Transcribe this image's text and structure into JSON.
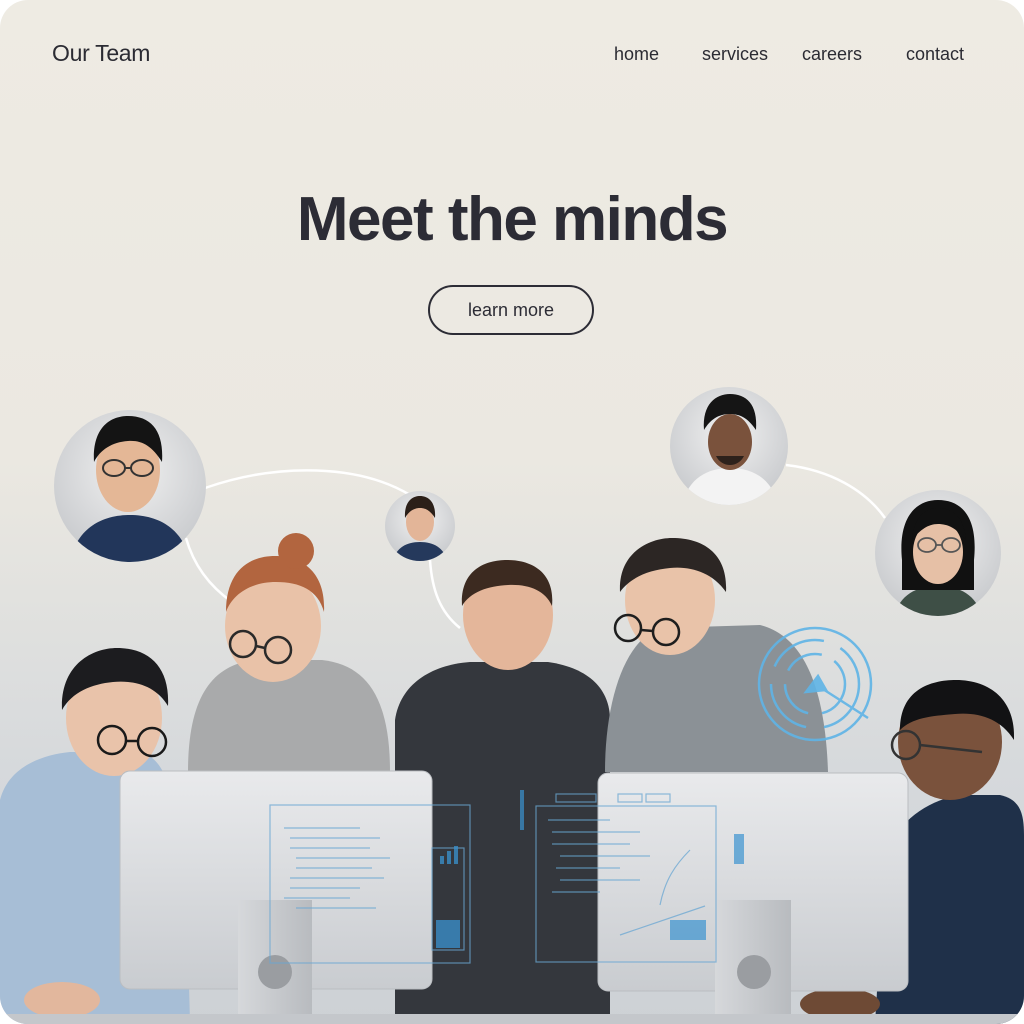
{
  "header": {
    "brand": "Our Team",
    "nav": [
      {
        "label": "home"
      },
      {
        "label": "services"
      },
      {
        "label": "careers"
      },
      {
        "label": "contact"
      }
    ]
  },
  "hero": {
    "headline": "Meet the minds",
    "cta_label": "learn more"
  },
  "colors": {
    "text": "#2c2c35",
    "background": "#eeebe3",
    "accent_hud": "#5fb4e6"
  },
  "icons": [
    "avatar-network",
    "hud-radial-icon",
    "monitor"
  ]
}
